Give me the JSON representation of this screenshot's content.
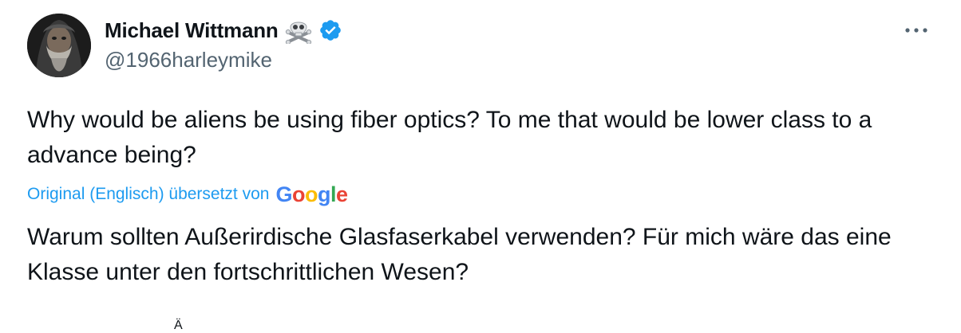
{
  "author": {
    "display_name": "Michael Wittmann",
    "handle": "@1966harleymike",
    "badge_emoji_icon": "skull-and-crossbones-icon",
    "verified_icon": "verified-badge-icon",
    "verified_color": "#1d9bf0"
  },
  "menu": {
    "more_icon": "more-options-icon"
  },
  "post": {
    "original_text": "Why would be aliens be using fiber optics? To me that would be lower class to a advance being?",
    "translation_label": "Original (Englisch) übersetzt von",
    "translation_provider": "Google",
    "translated_text": "Warum sollten Außerirdische Glasfaserkabel verwenden? Für mich wäre das eine Klasse unter den fortschrittlichen Wesen?"
  },
  "colors": {
    "text_primary": "#0f1419",
    "text_secondary": "#536471",
    "link": "#1d9bf0",
    "google_blue": "#4285f4",
    "google_red": "#ea4335",
    "google_yellow": "#fbbc05",
    "google_green": "#34a853"
  },
  "clipped_footer_char": "Ä"
}
